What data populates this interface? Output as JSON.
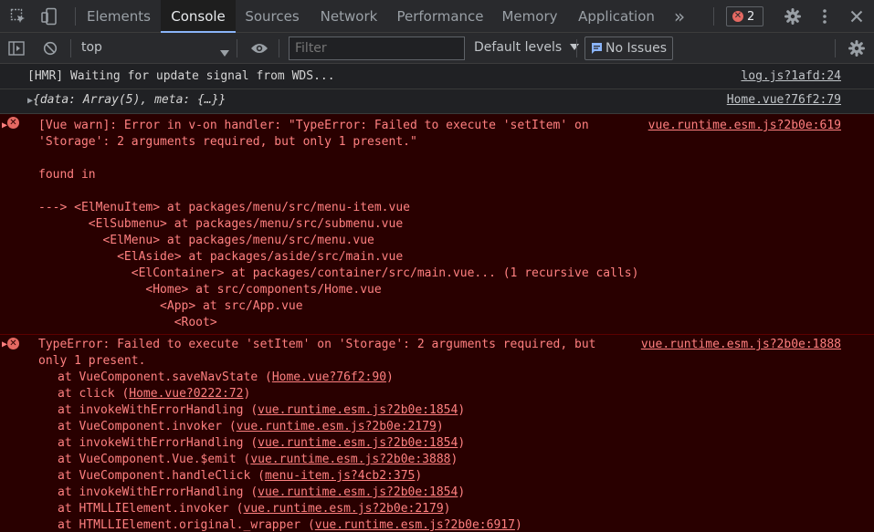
{
  "tabs": [
    {
      "label": "Elements"
    },
    {
      "label": "Console"
    },
    {
      "label": "Sources"
    },
    {
      "label": "Network"
    },
    {
      "label": "Performance"
    },
    {
      "label": "Memory"
    },
    {
      "label": "Application"
    }
  ],
  "tabbar": {
    "more_tabs": "»",
    "error_count": "2"
  },
  "toolbar": {
    "context": "top",
    "filter_placeholder": "Filter",
    "levels": "Default levels",
    "issues": "No Issues"
  },
  "messages": [
    {
      "text": "[HMR] Waiting for update signal from WDS...",
      "source": "log.js?1afd:24"
    },
    {
      "text": "{data: Array(5), meta: {…}}",
      "source": "Home.vue?76f2:79"
    },
    {
      "text": "[Vue warn]: Error in v-on handler: \"TypeError: Failed to execute 'setItem' on\n'Storage': 2 arguments required, but only 1 present.\"\n\nfound in\n\n---> <ElMenuItem> at packages/menu/src/menu-item.vue\n       <ElSubmenu> at packages/menu/src/submenu.vue\n         <ElMenu> at packages/menu/src/menu.vue\n           <ElAside> at packages/aside/src/main.vue\n             <ElContainer> at packages/container/src/main.vue... (1 recursive calls)\n               <Home> at src/components/Home.vue\n                 <App> at src/App.vue\n                   <Root>",
      "source": "vue.runtime.esm.js?2b0e:619"
    },
    {
      "head": "TypeError: Failed to execute 'setItem' on 'Storage': 2 arguments required, but\nonly 1 present.",
      "source": "vue.runtime.esm.js?2b0e:1888",
      "stack": [
        {
          "fn": "VueComponent.saveNavState",
          "loc": "Home.vue?76f2:90"
        },
        {
          "fn": "click",
          "loc": "Home.vue?0222:72"
        },
        {
          "fn": "invokeWithErrorHandling",
          "loc": "vue.runtime.esm.js?2b0e:1854"
        },
        {
          "fn": "VueComponent.invoker",
          "loc": "vue.runtime.esm.js?2b0e:2179"
        },
        {
          "fn": "invokeWithErrorHandling",
          "loc": "vue.runtime.esm.js?2b0e:1854"
        },
        {
          "fn": "VueComponent.Vue.$emit",
          "loc": "vue.runtime.esm.js?2b0e:3888"
        },
        {
          "fn": "VueComponent.handleClick",
          "loc": "menu-item.js?4cb2:375"
        },
        {
          "fn": "invokeWithErrorHandling",
          "loc": "vue.runtime.esm.js?2b0e:1854"
        },
        {
          "fn": "HTMLLIElement.invoker",
          "loc": "vue.runtime.esm.js?2b0e:2179"
        },
        {
          "fn": "HTMLLIElement.original._wrapper",
          "loc": "vue.runtime.esm.js?2b0e:6917"
        }
      ]
    }
  ]
}
